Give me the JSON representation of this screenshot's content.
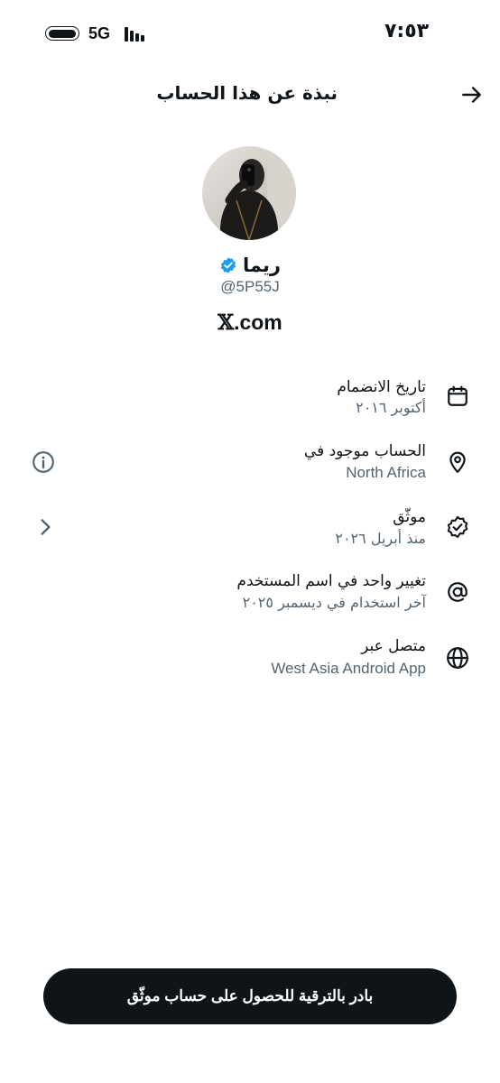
{
  "status_bar": {
    "time": "٧:٥٣",
    "network": "5G"
  },
  "header": {
    "title": "نبذة عن هذا الحساب"
  },
  "profile": {
    "name": "ريما",
    "handle": "@5P55J",
    "domain_x": "𝕏",
    "domain_rest": ".com"
  },
  "rows": [
    {
      "icon": "calendar-icon",
      "title": "تاريخ الانضمام",
      "subtitle": "أكتوبر ٢٠١٦"
    },
    {
      "icon": "location-pin-icon",
      "title": "الحساب موجود في",
      "subtitle": "North Africa",
      "side_icon": "info-icon"
    },
    {
      "icon": "verified-badge-icon",
      "title": "موثّق",
      "subtitle": "منذ أبريل ٢٠٢٦",
      "side_icon": "chevron-icon"
    },
    {
      "icon": "at-sign-icon",
      "title": "تغيير واحد في اسم المستخدم",
      "subtitle": "آخر استخدام في ديسمبر ٢٠٢٥"
    },
    {
      "icon": "globe-icon",
      "title": "متصل عبر",
      "subtitle": "West Asia Android App"
    }
  ],
  "cta": {
    "label": "بادر بالترقية للحصول على حساب موثّق"
  },
  "colors": {
    "text": "#0f1419",
    "secondary": "#536471",
    "verified_blue": "#1d9bf0",
    "button_bg": "#0f1419"
  }
}
